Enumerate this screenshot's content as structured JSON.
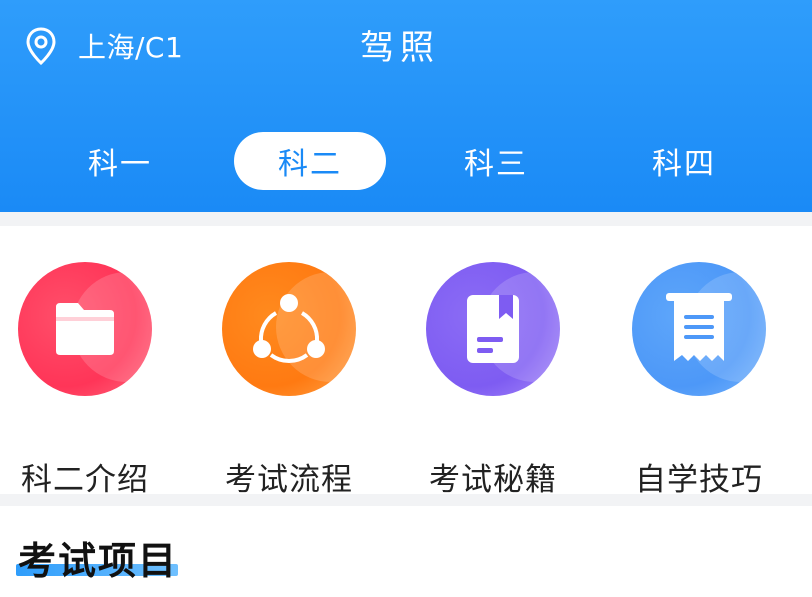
{
  "header": {
    "location": "上海/C1",
    "title": "驾照"
  },
  "tabs": [
    {
      "label": "科一",
      "active": false
    },
    {
      "label": "科二",
      "active": true
    },
    {
      "label": "科三",
      "active": false
    },
    {
      "label": "科四",
      "active": false
    }
  ],
  "features": [
    {
      "label": "科二介绍",
      "icon": "folder-icon",
      "color": "#ff3558"
    },
    {
      "label": "考试流程",
      "icon": "share-nodes-icon",
      "color": "#ff7a12"
    },
    {
      "label": "考试秘籍",
      "icon": "bookmark-book-icon",
      "color": "#7e5cf2"
    },
    {
      "label": "自学技巧",
      "icon": "receipt-icon",
      "color": "#4d98f8"
    }
  ],
  "section": {
    "title": "考试项目"
  },
  "colors": {
    "header_blue": "#1a8af6",
    "page_gap": "#f2f3f5"
  }
}
